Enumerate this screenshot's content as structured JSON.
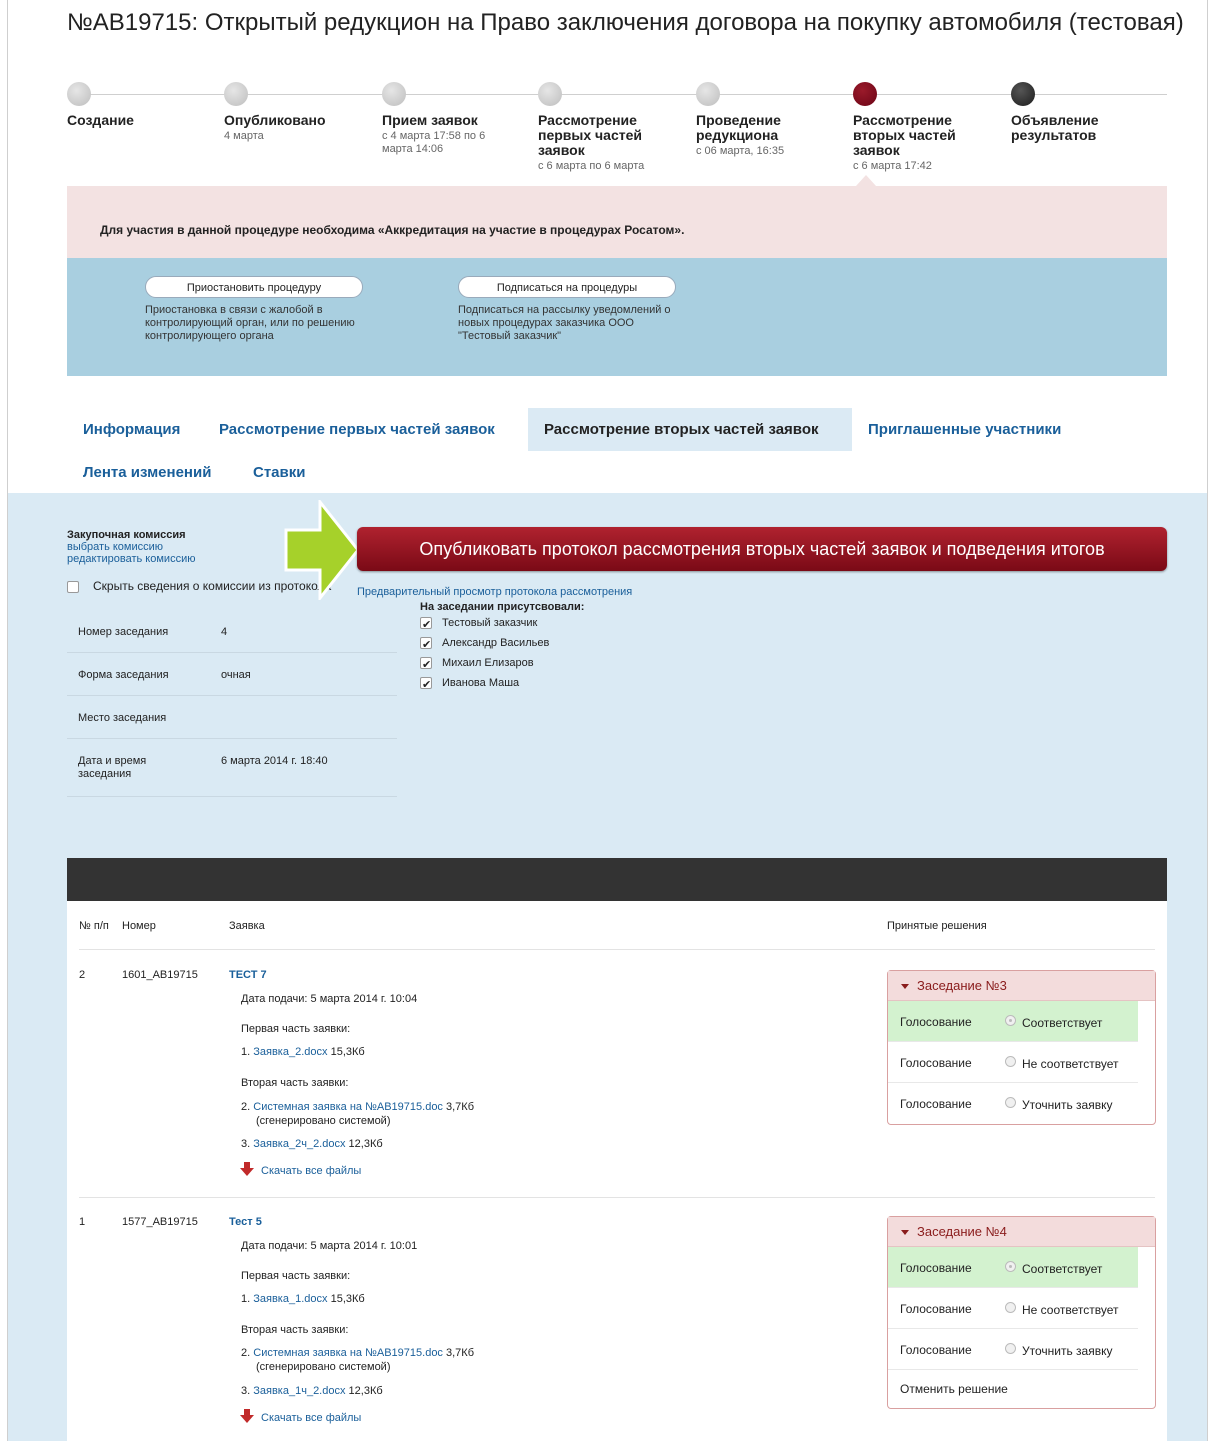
{
  "title": "№AB19715: Открытый редукцион на Право заключения договора на покупку автомобиля (тестовая)",
  "steps": [
    {
      "label": "Создание",
      "sub": ""
    },
    {
      "label": "Опубликовано",
      "sub": "4 марта"
    },
    {
      "label": "Прием заявок",
      "sub": "с 4 марта 17:58 по 6 марта 14:06"
    },
    {
      "label": "Рассмотрение первых частей заявок",
      "sub": "с 6 марта по 6 марта"
    },
    {
      "label": "Проведение редукциона",
      "sub": "с 06 марта, 16:35"
    },
    {
      "label": "Рассмотрение вторых частей заявок",
      "sub": "с 6 марта 17:42"
    },
    {
      "label": "Объявление результатов",
      "sub": ""
    }
  ],
  "notice": "Для участия в данной процедуре необходима «Аккредитация на участие в процедурах Росатом».",
  "actions": {
    "suspend": {
      "label": "Приостановить процедуру",
      "desc": "Приостановка в связи с жалобой в контролирующий орган, или по решению контролирующего органа"
    },
    "subscribe": {
      "label": "Подписаться на процедуры",
      "desc": "Подписаться на рассылку уведомлений о новых процедурах заказчика ООО \"Тестовый заказчик\""
    }
  },
  "tabs": [
    "Информация",
    "Рассмотрение первых частей заявок",
    "Рассмотрение вторых частей заявок",
    "Приглашенные участники",
    "Лента изменений",
    "Ставки"
  ],
  "commission": {
    "heading": "Закупочная комиссия",
    "choose": "выбрать комиссию",
    "edit": "редактировать комиссию",
    "hide": "Скрыть сведения о комиссии из протокола"
  },
  "publish_label": "Опубликовать протокол рассмотрения вторых частей заявок и подведения итогов",
  "preview_label": "Предварительный просмотр протокола рассмотрения",
  "attendance": {
    "heading": "На заседании присутсвовали:",
    "people": [
      "Тестовый заказчик",
      "Александр Васильев",
      "Михаил Елизаров",
      "Иванова Маша"
    ]
  },
  "meeting": {
    "number_key": "Номер заседания",
    "number_val": "4",
    "form_key": "Форма заседания",
    "form_val": "очная",
    "place_key": "Место заседания",
    "place_val": "",
    "date_key": "Дата и время заседания",
    "date_val": "6 марта 2014 г. 18:40"
  },
  "table": {
    "headers": {
      "num": "№ п/п",
      "number": "Номер",
      "request": "Заявка",
      "decisions": "Принятые решения"
    },
    "rows": [
      {
        "idx": "2",
        "number": "1601_AB19715",
        "name": "ТЕСТ 7",
        "date": "Дата подачи: 5 марта 2014 г. 10:04",
        "part1": "Первая часть заявки:",
        "file1_num": "1.",
        "file1": "Заявка_2.docx",
        "file1_size": "15,3Кб",
        "part2": "Вторая часть заявки:",
        "file2_num": "2.",
        "file2": "Системная заявка на №AB19715.doc",
        "file2_size": "3,7Кб",
        "file2_note": "(сгенерировано системой)",
        "file3_num": "3.",
        "file3": "Заявка_2ч_2.docx",
        "file3_size": "12,3Кб",
        "download": "Скачать все файлы",
        "session": "Заседание №3",
        "votes": [
          {
            "label": "Голосование",
            "option": "Соответствует"
          },
          {
            "label": "Голосование",
            "option": "Не соответствует"
          },
          {
            "label": "Голосование",
            "option": "Уточнить заявку"
          }
        ]
      },
      {
        "idx": "1",
        "number": "1577_AB19715",
        "name": "Тест 5",
        "date": "Дата подачи: 5 марта 2014 г. 10:01",
        "part1": "Первая часть заявки:",
        "file1_num": "1.",
        "file1": "Заявка_1.docx",
        "file1_size": "15,3Кб",
        "part2": "Вторая часть заявки:",
        "file2_num": "2.",
        "file2": "Системная заявка на №AB19715.doc",
        "file2_size": "3,7Кб",
        "file2_note": "(сгенерировано системой)",
        "file3_num": "3.",
        "file3": "Заявка_1ч_2.docx",
        "file3_size": "12,3Кб",
        "download": "Скачать все файлы",
        "session": "Заседание №4",
        "votes": [
          {
            "label": "Голосование",
            "option": "Соответствует"
          },
          {
            "label": "Голосование",
            "option": "Не соответствует"
          },
          {
            "label": "Голосование",
            "option": "Уточнить заявку"
          }
        ],
        "cancel": "Отменить решение"
      }
    ]
  },
  "colors": {
    "accent": "#7a0a16",
    "link": "#1a5f9a",
    "panel": "#daeaf4",
    "approved": "#d3f2cf",
    "arrow": "#a6d12a"
  }
}
